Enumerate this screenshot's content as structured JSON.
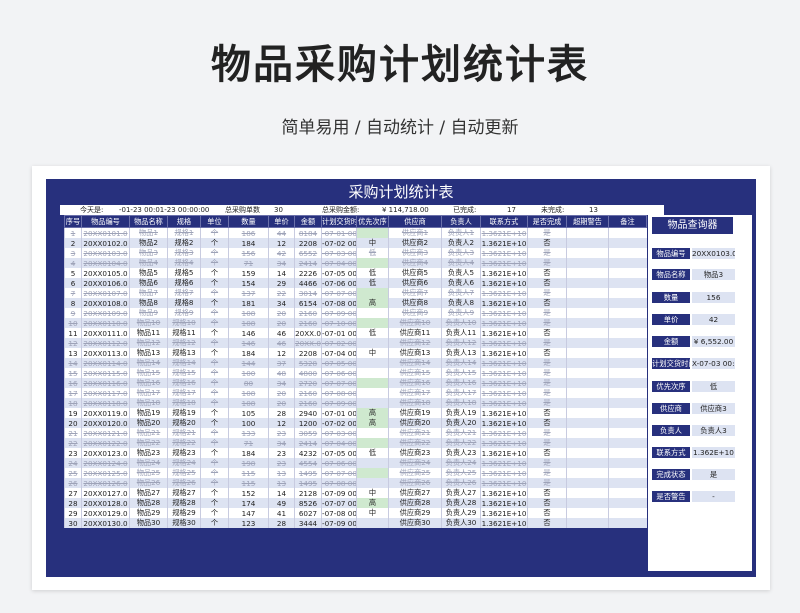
{
  "hero": {
    "title": "物品采购计划统计表",
    "subtitle": "简单易用 / 自动统计 / 自动更新"
  },
  "sheet": {
    "title": "采购计划统计表",
    "info": {
      "today_label": "今天是:",
      "today_value": "-01-23 00:01-23 00:00:00",
      "total_qty_label": "总采购单数",
      "total_qty": "30",
      "total_amount_label": "总采购金额:",
      "total_amount": "¥ 114,718.00",
      "done_label": "已完成:",
      "done": "17",
      "undone_label": "未完成:",
      "undone": "13"
    },
    "headers": [
      "序号",
      "物品编号",
      "物品名称",
      "规格",
      "单位",
      "数量",
      "单价",
      "金额",
      "计划交货时",
      "优先次序",
      "供应商",
      "负责人",
      "联系方式",
      "是否完成",
      "超期警告",
      "备注"
    ],
    "rows": [
      [
        "1",
        "20XX0101.0",
        "物品1",
        "规格1",
        "个",
        "186",
        "44",
        "8184",
        "-07-01 00:",
        "",
        "供应商1",
        "负责人1",
        "1.3621E+10",
        "是",
        "",
        ""
      ],
      [
        "2",
        "20XX0102.0",
        "物品2",
        "规格2",
        "个",
        "184",
        "12",
        "2208",
        "-07-02 00:",
        "中",
        "供应商2",
        "负责人2",
        "1.3621E+10",
        "否",
        "",
        ""
      ],
      [
        "3",
        "20XX0103.0",
        "物品3",
        "规格3",
        "个",
        "156",
        "42",
        "6552",
        "-07-03 00:",
        "低",
        "供应商3",
        "负责人3",
        "1.3621E+10",
        "是",
        "",
        ""
      ],
      [
        "4",
        "20XX0104.0",
        "物品4",
        "规格4",
        "个",
        "71",
        "34",
        "2414",
        "-07-04 00:",
        "",
        "供应商4",
        "负责人4",
        "1.3621E+10",
        "是",
        "",
        ""
      ],
      [
        "5",
        "20XX0105.0",
        "物品5",
        "规格5",
        "个",
        "159",
        "14",
        "2226",
        "-07-05 00:",
        "低",
        "供应商5",
        "负责人5",
        "1.3621E+10",
        "否",
        "",
        ""
      ],
      [
        "6",
        "20XX0106.0",
        "物品6",
        "规格6",
        "个",
        "154",
        "29",
        "4466",
        "-07-06 00:",
        "低",
        "供应商6",
        "负责人6",
        "1.3621E+10",
        "否",
        "",
        ""
      ],
      [
        "7",
        "20XX0107.0",
        "物品7",
        "规格7",
        "个",
        "137",
        "22",
        "3014",
        "-07-07 00:",
        "",
        "供应商7",
        "负责人7",
        "1.3621E+10",
        "是",
        "",
        ""
      ],
      [
        "8",
        "20XX0108.0",
        "物品8",
        "规格8",
        "个",
        "181",
        "34",
        "6154",
        "-07-08 00:",
        "高",
        "供应商8",
        "负责人8",
        "1.3621E+10",
        "否",
        "",
        ""
      ],
      [
        "9",
        "20XX0109.0",
        "物品9",
        "规格9",
        "个",
        "108",
        "20",
        "2160",
        "-07-09 00:",
        "",
        "供应商9",
        "负责人9",
        "1.3621E+10",
        "是",
        "",
        ""
      ],
      [
        "10",
        "20XX0110.0",
        "物品10",
        "规格10",
        "个",
        "108",
        "20",
        "2160",
        "-07-10 00:",
        "",
        "供应商10",
        "负责人10",
        "1.3621E+10",
        "是",
        "",
        ""
      ],
      [
        "11",
        "20XX0111.0",
        "物品11",
        "规格11",
        "个",
        "146",
        "46",
        "20XX.0",
        "-07-01 00:",
        "低",
        "供应商11",
        "负责人11",
        "1.3621E+10",
        "否",
        "",
        ""
      ],
      [
        "12",
        "20XX0112.0",
        "物品12",
        "规格12",
        "个",
        "146",
        "46",
        "20XX.0",
        "-07-02 00:",
        "",
        "供应商12",
        "负责人12",
        "1.3621E+10",
        "是",
        "",
        ""
      ],
      [
        "13",
        "20XX0113.0",
        "物品13",
        "规格13",
        "个",
        "184",
        "12",
        "2208",
        "-07-04 00:",
        "中",
        "供应商13",
        "负责人13",
        "1.3621E+10",
        "否",
        "",
        ""
      ],
      [
        "14",
        "20XX0114.0",
        "物品14",
        "规格14",
        "个",
        "144",
        "37",
        "5328",
        "-07-05 00:",
        "",
        "供应商14",
        "负责人14",
        "1.3621E+10",
        "是",
        "",
        ""
      ],
      [
        "15",
        "20XX0115.0",
        "物品15",
        "规格15",
        "个",
        "100",
        "48",
        "4800",
        "-07-06 00:",
        "",
        "供应商15",
        "负责人15",
        "1.3621E+10",
        "是",
        "",
        ""
      ],
      [
        "16",
        "20XX0116.0",
        "物品16",
        "规格16",
        "个",
        "80",
        "34",
        "2720",
        "-07-07 00:",
        "",
        "供应商16",
        "负责人16",
        "1.3621E+10",
        "是",
        "",
        ""
      ],
      [
        "17",
        "20XX0117.0",
        "物品17",
        "规格17",
        "个",
        "108",
        "20",
        "2160",
        "-07-08 00:",
        "",
        "供应商17",
        "负责人17",
        "1.3621E+10",
        "是",
        "",
        ""
      ],
      [
        "18",
        "20XX0118.0",
        "物品18",
        "规格18",
        "个",
        "108",
        "20",
        "2160",
        "-07-09 00:",
        "",
        "供应商18",
        "负责人18",
        "1.3621E+10",
        "是",
        "",
        ""
      ],
      [
        "19",
        "20XX0119.0",
        "物品19",
        "规格19",
        "个",
        "105",
        "28",
        "2940",
        "-07-01 00:",
        "高",
        "供应商19",
        "负责人19",
        "1.3621E+10",
        "否",
        "",
        ""
      ],
      [
        "20",
        "20XX0120.0",
        "物品20",
        "规格20",
        "个",
        "100",
        "12",
        "1200",
        "-07-02 00:",
        "高",
        "供应商20",
        "负责人20",
        "1.3621E+10",
        "否",
        "",
        ""
      ],
      [
        "21",
        "20XX0121.0",
        "物品21",
        "规格21",
        "个",
        "133",
        "23",
        "3059",
        "-07-03 00:",
        "",
        "供应商21",
        "负责人21",
        "1.3621E+10",
        "是",
        "",
        ""
      ],
      [
        "22",
        "20XX0122.0",
        "物品22",
        "规格22",
        "个",
        "71",
        "34",
        "2414",
        "-07-04 00:",
        "",
        "供应商22",
        "负责人22",
        "1.3621E+10",
        "是",
        "",
        ""
      ],
      [
        "23",
        "20XX0123.0",
        "物品23",
        "规格23",
        "个",
        "184",
        "23",
        "4232",
        "-07-05 00:",
        "低",
        "供应商23",
        "负责人23",
        "1.3621E+10",
        "否",
        "",
        ""
      ],
      [
        "24",
        "20XX0124.0",
        "物品24",
        "规格24",
        "个",
        "198",
        "23",
        "4554",
        "-07-06 00:",
        "",
        "供应商24",
        "负责人24",
        "1.3621E+10",
        "是",
        "",
        ""
      ],
      [
        "25",
        "20XX0125.0",
        "物品25",
        "规格25",
        "个",
        "115",
        "13",
        "1495",
        "-07-07 00:",
        "",
        "供应商25",
        "负责人25",
        "1.3621E+10",
        "是",
        "",
        ""
      ],
      [
        "26",
        "20XX0126.0",
        "物品26",
        "规格26",
        "个",
        "115",
        "13",
        "1495",
        "-07-08 00:",
        "",
        "供应商26",
        "负责人26",
        "1.3621E+10",
        "是",
        "",
        ""
      ],
      [
        "27",
        "20XX0127.0",
        "物品27",
        "规格27",
        "个",
        "152",
        "14",
        "2128",
        "-07-09 00:",
        "中",
        "供应商27",
        "负责人27",
        "1.3621E+10",
        "否",
        "",
        ""
      ],
      [
        "28",
        "20XX0128.0",
        "物品28",
        "规格28",
        "个",
        "174",
        "49",
        "8526",
        "-07-07 00:",
        "高",
        "供应商28",
        "负责人28",
        "1.3621E+10",
        "否",
        "",
        ""
      ],
      [
        "29",
        "20XX0129.0",
        "物品29",
        "规格29",
        "个",
        "147",
        "41",
        "6027",
        "-07-08 00:",
        "中",
        "供应商29",
        "负责人29",
        "1.3621E+10",
        "否",
        "",
        ""
      ],
      [
        "30",
        "20XX0130.0",
        "物品30",
        "规格30",
        "个",
        "123",
        "28",
        "3444",
        "-07-09 00:",
        "",
        "供应商30",
        "负责人30",
        "1.3621E+10",
        "否",
        "",
        ""
      ]
    ]
  },
  "query": {
    "title": "物品查询器",
    "fields": [
      {
        "label": "物品编号",
        "value": "20XX0103.0"
      },
      {
        "label": "物品名称",
        "value": "物品3"
      },
      {
        "label": "数量",
        "value": "156"
      },
      {
        "label": "单价",
        "value": "42"
      },
      {
        "label": "金额",
        "value": "¥ 6,552.00"
      },
      {
        "label": "计划交货时间",
        "value": "X-07-03 00:00:0"
      },
      {
        "label": "优先次序",
        "value": "低"
      },
      {
        "label": "供应商",
        "value": "供应商3"
      },
      {
        "label": "负责人",
        "value": "负责人3"
      },
      {
        "label": "联系方式",
        "value": "1.362E+10"
      },
      {
        "label": "完成状态",
        "value": "是"
      },
      {
        "label": "是否警告",
        "value": "-"
      }
    ]
  },
  "colors": {
    "navy": "#27307d",
    "row_alt": "#dde3f2",
    "priority_green": "#cfe9cf"
  }
}
